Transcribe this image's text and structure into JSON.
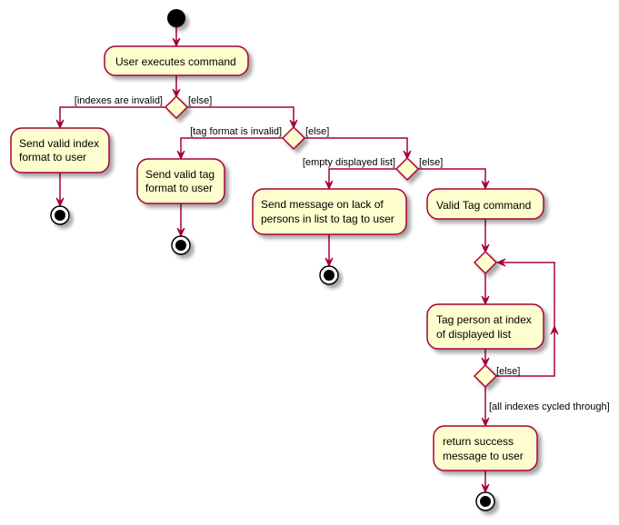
{
  "diagram": {
    "type": "activity",
    "colors": {
      "line": "#A80036",
      "fill": "#FEFECE",
      "node": "#000000",
      "shadow": "#BBBBBB"
    },
    "actions": {
      "user_executes": [
        "User executes command"
      ],
      "send_index_format": [
        "Send valid index",
        "format to user"
      ],
      "send_tag_format": [
        "Send valid tag",
        "format to user"
      ],
      "send_lack_message": [
        "Send message on lack of",
        "persons in list to tag to user"
      ],
      "valid_tag": [
        "Valid Tag command"
      ],
      "tag_person": [
        "Tag person at index",
        "of displayed list"
      ],
      "return_success": [
        "return success",
        "message to user"
      ]
    },
    "guards": {
      "indexes_invalid": "[indexes are invalid]",
      "else_1": "[else]",
      "tag_format_invalid": "[tag format is invalid]",
      "else_2": "[else]",
      "empty_list": "[empty displayed list]",
      "else_3": "[else]",
      "loop_else": "[else]",
      "all_cycled": "[all indexes cycled through]"
    }
  }
}
